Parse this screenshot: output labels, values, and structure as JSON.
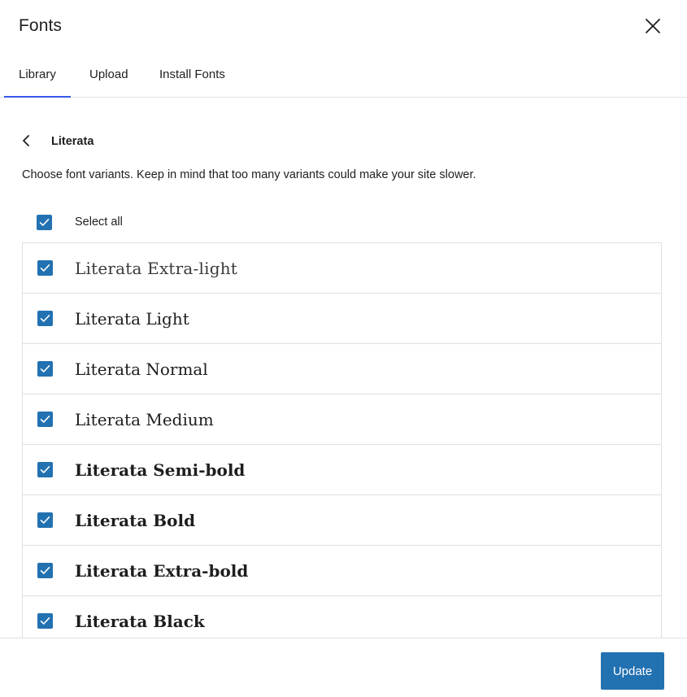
{
  "modal": {
    "title": "Fonts"
  },
  "tabs": [
    {
      "label": "Library",
      "active": true
    },
    {
      "label": "Upload",
      "active": false
    },
    {
      "label": "Install Fonts",
      "active": false
    }
  ],
  "library": {
    "family_name": "Literata",
    "description": "Choose font variants. Keep in mind that too many variants could make your site slower.",
    "select_all_label": "Select all",
    "select_all_checked": true,
    "variants": [
      {
        "label": "Literata Extra-light",
        "checked": true
      },
      {
        "label": "Literata Light",
        "checked": true
      },
      {
        "label": "Literata Normal",
        "checked": true
      },
      {
        "label": "Literata Medium",
        "checked": true
      },
      {
        "label": "Literata Semi-bold",
        "checked": true
      },
      {
        "label": "Literata Bold",
        "checked": true
      },
      {
        "label": "Literata Extra-bold",
        "checked": true
      },
      {
        "label": "Literata Black",
        "checked": true
      }
    ]
  },
  "footer": {
    "update_label": "Update"
  },
  "colors": {
    "accent": "#2271b1",
    "tab_indicator": "#3858e9",
    "border": "#e0e0e0",
    "text": "#1e1e1e"
  },
  "icons": {
    "close": "close-icon",
    "back": "chevron-left-icon",
    "check": "checkmark-icon"
  }
}
